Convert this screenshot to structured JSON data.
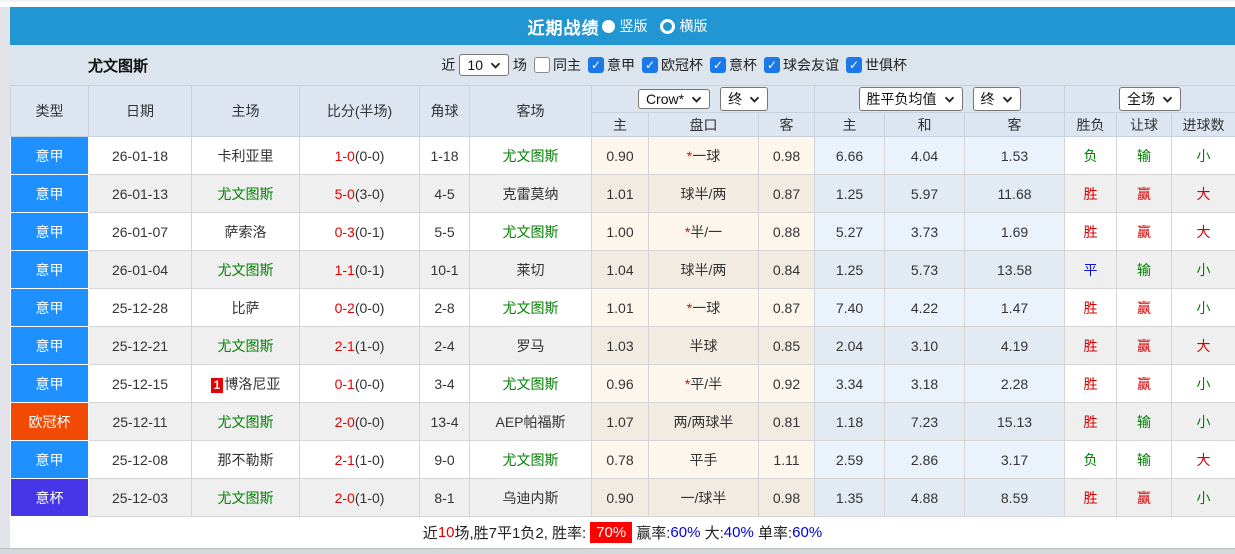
{
  "titlebar": {
    "title": "近期战绩",
    "radios": [
      {
        "label": "竖版",
        "selected": true
      },
      {
        "label": "横版",
        "selected": false
      }
    ]
  },
  "filter": {
    "team": "尤文图斯",
    "near_label": "近",
    "games_value": "10",
    "games_label": "场",
    "checkboxes": [
      {
        "label": "同主",
        "checked": false
      },
      {
        "label": "意甲",
        "checked": true
      },
      {
        "label": "欧冠杯",
        "checked": true
      },
      {
        "label": "意杯",
        "checked": true
      },
      {
        "label": "球会友谊",
        "checked": true
      },
      {
        "label": "世俱杯",
        "checked": true
      }
    ]
  },
  "colors": {
    "title_bar": "#2196d3",
    "checkbox_blue": "#1b78e9",
    "juve_green": "#008000",
    "score_red": "#e60000",
    "league": {
      "意甲": "#1e90ff",
      "欧冠杯": "#f24a02",
      "意杯": "#4636e8"
    },
    "result": {
      "胜": "r-red",
      "平": "r-blue",
      "负": "r-green",
      "赢": "r-red",
      "输": "r-green",
      "大": "r-red",
      "小": "r-green"
    }
  },
  "table": {
    "headers": [
      "类型",
      "日期",
      "主场",
      "比分(半场)",
      "角球",
      "客场"
    ],
    "selects": {
      "company": "Crow*",
      "final1": "终",
      "mean": "胜平负均值",
      "final2": "终",
      "scope": "全场"
    },
    "subheaders": [
      "主",
      "盘口",
      "客",
      "主",
      "和",
      "客",
      "胜负",
      "让球",
      "进球数"
    ],
    "rows": [
      {
        "league": "意甲",
        "date": "26-01-18",
        "home": "卡利亚里",
        "home_juve": false,
        "home_rank": "",
        "score": "1-0",
        "half": "(0-0)",
        "corners": "1-18",
        "away": "尤文图斯",
        "away_juve": true,
        "odds": [
          "0.90",
          "*一球",
          "0.98"
        ],
        "means": [
          "6.66",
          "4.04",
          "1.53"
        ],
        "results": [
          "负",
          "输",
          "小"
        ]
      },
      {
        "league": "意甲",
        "date": "26-01-13",
        "home": "尤文图斯",
        "home_juve": true,
        "home_rank": "",
        "score": "5-0",
        "half": "(3-0)",
        "corners": "4-5",
        "away": "克雷莫纳",
        "away_juve": false,
        "odds": [
          "1.01",
          "球半/两",
          "0.87"
        ],
        "means": [
          "1.25",
          "5.97",
          "11.68"
        ],
        "results": [
          "胜",
          "赢",
          "大"
        ]
      },
      {
        "league": "意甲",
        "date": "26-01-07",
        "home": "萨索洛",
        "home_juve": false,
        "home_rank": "",
        "score": "0-3",
        "half": "(0-1)",
        "corners": "5-5",
        "away": "尤文图斯",
        "away_juve": true,
        "odds": [
          "1.00",
          "*半/一",
          "0.88"
        ],
        "means": [
          "5.27",
          "3.73",
          "1.69"
        ],
        "results": [
          "胜",
          "赢",
          "大"
        ]
      },
      {
        "league": "意甲",
        "date": "26-01-04",
        "home": "尤文图斯",
        "home_juve": true,
        "home_rank": "",
        "score": "1-1",
        "half": "(0-1)",
        "corners": "10-1",
        "away": "莱切",
        "away_juve": false,
        "odds": [
          "1.04",
          "球半/两",
          "0.84"
        ],
        "means": [
          "1.25",
          "5.73",
          "13.58"
        ],
        "results": [
          "平",
          "输",
          "小"
        ]
      },
      {
        "league": "意甲",
        "date": "25-12-28",
        "home": "比萨",
        "home_juve": false,
        "home_rank": "",
        "score": "0-2",
        "half": "(0-0)",
        "corners": "2-8",
        "away": "尤文图斯",
        "away_juve": true,
        "odds": [
          "1.01",
          "*一球",
          "0.87"
        ],
        "means": [
          "7.40",
          "4.22",
          "1.47"
        ],
        "results": [
          "胜",
          "赢",
          "小"
        ]
      },
      {
        "league": "意甲",
        "date": "25-12-21",
        "home": "尤文图斯",
        "home_juve": true,
        "home_rank": "",
        "score": "2-1",
        "half": "(1-0)",
        "corners": "2-4",
        "away": "罗马",
        "away_juve": false,
        "odds": [
          "1.03",
          "半球",
          "0.85"
        ],
        "means": [
          "2.04",
          "3.10",
          "4.19"
        ],
        "results": [
          "胜",
          "赢",
          "大"
        ]
      },
      {
        "league": "意甲",
        "date": "25-12-15",
        "home": "博洛尼亚",
        "home_juve": false,
        "home_rank": "1",
        "score": "0-1",
        "half": "(0-0)",
        "corners": "3-4",
        "away": "尤文图斯",
        "away_juve": true,
        "odds": [
          "0.96",
          "*平/半",
          "0.92"
        ],
        "means": [
          "3.34",
          "3.18",
          "2.28"
        ],
        "results": [
          "胜",
          "赢",
          "小"
        ]
      },
      {
        "league": "欧冠杯",
        "date": "25-12-11",
        "home": "尤文图斯",
        "home_juve": true,
        "home_rank": "",
        "score": "2-0",
        "half": "(0-0)",
        "corners": "13-4",
        "away": "AEP帕福斯",
        "away_juve": false,
        "odds": [
          "1.07",
          "两/两球半",
          "0.81"
        ],
        "means": [
          "1.18",
          "7.23",
          "15.13"
        ],
        "results": [
          "胜",
          "输",
          "小"
        ]
      },
      {
        "league": "意甲",
        "date": "25-12-08",
        "home": "那不勒斯",
        "home_juve": false,
        "home_rank": "",
        "score": "2-1",
        "half": "(1-0)",
        "corners": "9-0",
        "away": "尤文图斯",
        "away_juve": true,
        "odds": [
          "0.78",
          "平手",
          "1.11"
        ],
        "means": [
          "2.59",
          "2.86",
          "3.17"
        ],
        "results": [
          "负",
          "输",
          "大"
        ]
      },
      {
        "league": "意杯",
        "date": "25-12-03",
        "home": "尤文图斯",
        "home_juve": true,
        "home_rank": "",
        "score": "2-0",
        "half": "(1-0)",
        "corners": "8-1",
        "away": "乌迪内斯",
        "away_juve": false,
        "odds": [
          "0.90",
          "一/球半",
          "0.98"
        ],
        "means": [
          "1.35",
          "4.88",
          "8.59"
        ],
        "results": [
          "胜",
          "赢",
          "小"
        ]
      }
    ]
  },
  "footer": {
    "segments": [
      {
        "text": "近",
        "style": "plain"
      },
      {
        "text": "10",
        "style": "red"
      },
      {
        "text": "场,胜7平1负2, 胜率:",
        "style": "plain"
      },
      {
        "text": "70%",
        "style": "badge"
      },
      {
        "text": "赢率:",
        "style": "plain"
      },
      {
        "text": "60%",
        "style": "blue"
      },
      {
        "text": " 大:",
        "style": "plain"
      },
      {
        "text": "40%",
        "style": "blue"
      },
      {
        "text": " 单率:",
        "style": "plain"
      },
      {
        "text": "60%",
        "style": "blue"
      }
    ]
  }
}
